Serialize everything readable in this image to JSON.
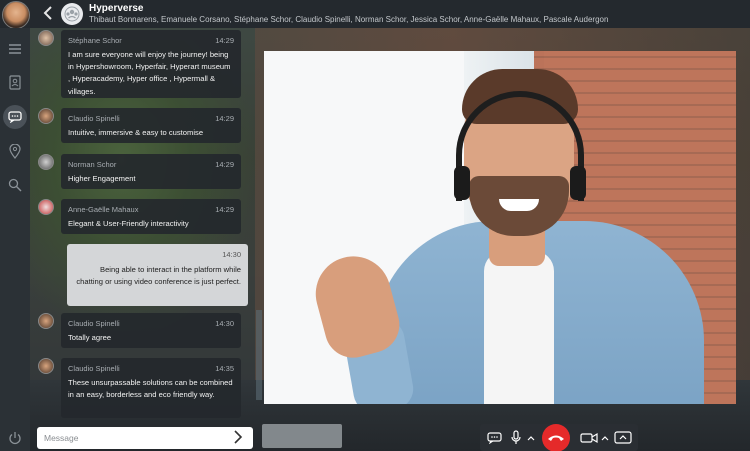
{
  "header": {
    "title": "Hyperverse",
    "members": "Thibaut Bonnarens, Emanuele Corsano, Stéphane Schor, Claudio Spinelli, Norman Schor, Jessica Schor, Anne-Gaëlle Mahaux, Pascale Audergon"
  },
  "sidebar": {
    "items": [
      {
        "icon": "hamburger-menu-icon"
      },
      {
        "icon": "contacts-book-icon"
      },
      {
        "icon": "chat-bubble-icon",
        "active": true
      },
      {
        "icon": "location-pin-icon"
      },
      {
        "icon": "search-icon"
      },
      {
        "icon": "power-icon"
      }
    ]
  },
  "messages": [
    {
      "name": "Stéphane Schor",
      "time": "14:29",
      "text": "I am sure everyone will enjoy the journey! being in Hypershowroom, Hyperfair, Hyperart museum , Hyperacademy, Hyper office , Hypermall & villages."
    },
    {
      "name": "Claudio Spinelli",
      "time": "14:29",
      "text": "Intuitive, immersive & easy to customise"
    },
    {
      "name": "Norman Schor",
      "time": "14:29",
      "text": "Higher Engagement"
    },
    {
      "name": "Anne-Gaëlle Mahaux",
      "time": "14:29",
      "text": "Elegant & User-Friendly interactivity"
    },
    {
      "name": "",
      "time": "14:30",
      "text": "Being able to interact in the platform while chatting or using video conference is just perfect."
    },
    {
      "name": "Claudio Spinelli",
      "time": "14:30",
      "text": "Totally agree"
    },
    {
      "name": "Claudio Spinelli",
      "time": "14:35",
      "text": "These unsurpassable solutions can be combined in an easy, borderless and eco friendly way."
    }
  ],
  "input": {
    "placeholder": "Message"
  },
  "call_controls": {
    "icons": [
      "chat-icon",
      "microphone-icon",
      "hang-up-icon",
      "camera-icon",
      "screen-share-icon"
    ]
  },
  "colors": {
    "hangup": "#e52a2a",
    "panel": "#24292e"
  }
}
